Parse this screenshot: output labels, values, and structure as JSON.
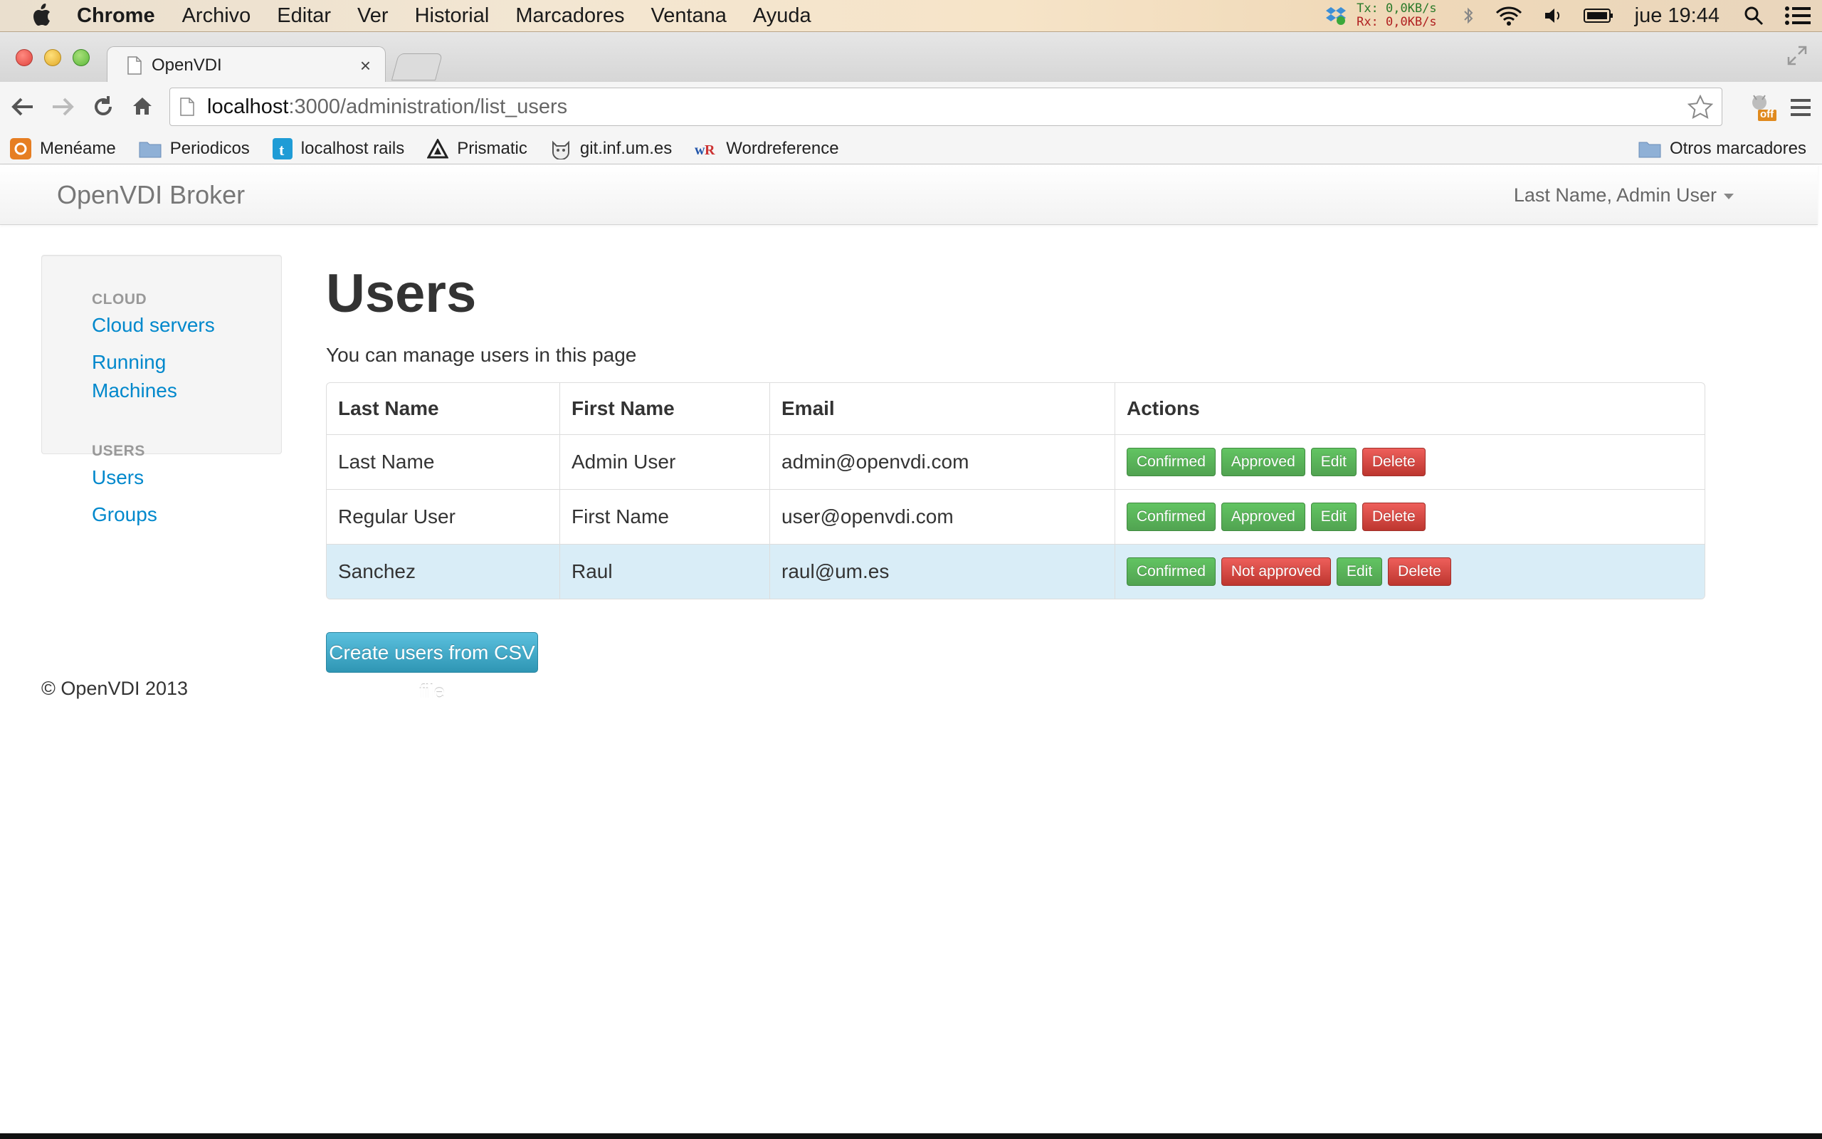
{
  "menubar": {
    "app_name": "Chrome",
    "menus": [
      "Archivo",
      "Editar",
      "Ver",
      "Historial",
      "Marcadores",
      "Ventana",
      "Ayuda"
    ],
    "net_tx": "Tx:  0,0KB/s",
    "net_rx": "Rx:  0,0KB/s",
    "clock": "jue 19:44"
  },
  "browser": {
    "tab_title": "OpenVDI",
    "tab_close": "×",
    "url_host": "localhost",
    "url_path": ":3000/administration/list_users",
    "extension_badge": "off",
    "bookmarks": [
      "Menéame",
      "Periodicos",
      "localhost rails",
      "Prismatic",
      "git.inf.um.es",
      "Wordreference"
    ],
    "other_bookmarks": "Otros marcadores"
  },
  "app": {
    "brand": "OpenVDI Broker",
    "user_menu": "Last Name, Admin User"
  },
  "sidebar": {
    "sections": [
      {
        "header": "CLOUD",
        "links": [
          "Cloud servers",
          "Running Machines"
        ]
      },
      {
        "header": "USERS",
        "links": [
          "Users",
          "Groups"
        ]
      }
    ]
  },
  "main": {
    "title": "Users",
    "subtitle": "You can manage users in this page",
    "table": {
      "headers": [
        "Last Name",
        "First Name",
        "Email",
        "Actions"
      ],
      "rows": [
        {
          "last_name": "Last Name",
          "first_name": "Admin User",
          "email": "admin@openvdi.com",
          "confirmed": "Confirmed",
          "approval": "Approved",
          "edit": "Edit",
          "delete": "Delete"
        },
        {
          "last_name": "Regular User",
          "first_name": "First Name",
          "email": "user@openvdi.com",
          "confirmed": "Confirmed",
          "approval": "Approved",
          "edit": "Edit",
          "delete": "Delete"
        },
        {
          "last_name": "Sanchez",
          "first_name": "Raul",
          "email": "raul@um.es",
          "confirmed": "Confirmed",
          "approval": "Not approved",
          "edit": "Edit",
          "delete": "Delete"
        }
      ]
    },
    "csv_button": "Create users from CSV file"
  },
  "footer": {
    "text": "© OpenVDI 2013"
  },
  "colors": {
    "link": "#0088cc",
    "success": "#5bb75b",
    "danger": "#da4f49",
    "info": "#49afcd",
    "highlight_row": "#d9edf7"
  }
}
